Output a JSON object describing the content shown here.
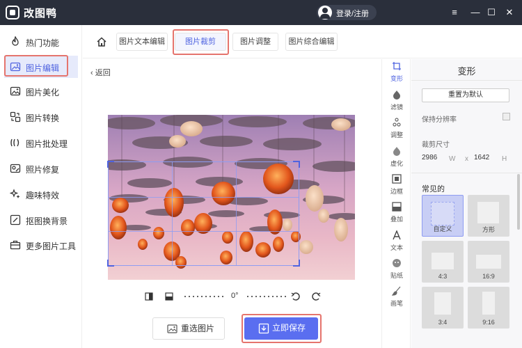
{
  "app": {
    "title": "改图鸭",
    "login": "登录/注册"
  },
  "window_controls": {
    "menu": "≡",
    "minimize": "—",
    "maximize": "☐",
    "close": "✕"
  },
  "sidebar": {
    "items": [
      {
        "label": "热门功能",
        "icon": "flame-icon"
      },
      {
        "label": "图片编辑",
        "icon": "image-edit-icon"
      },
      {
        "label": "图片美化",
        "icon": "image-beautify-icon"
      },
      {
        "label": "图片转换",
        "icon": "convert-icon"
      },
      {
        "label": "图片批处理",
        "icon": "batch-icon"
      },
      {
        "label": "照片修复",
        "icon": "repair-icon"
      },
      {
        "label": "趣味特效",
        "icon": "sparkle-icon"
      },
      {
        "label": "抠图换背景",
        "icon": "cutout-icon"
      },
      {
        "label": "更多图片工具",
        "icon": "toolbox-icon"
      }
    ],
    "active_index": 1
  },
  "tabs": [
    {
      "label": "图片文本编辑"
    },
    {
      "label": "图片裁剪"
    },
    {
      "label": "图片调整"
    },
    {
      "label": "图片综合编辑"
    }
  ],
  "active_tab": 1,
  "back_label": "返回",
  "rotation": {
    "degree": "0°"
  },
  "buttons": {
    "reselect": "重选图片",
    "save": "立即保存"
  },
  "tools": [
    {
      "label": "变形",
      "icon": "transform-icon"
    },
    {
      "label": "滤镜",
      "icon": "filter-icon"
    },
    {
      "label": "调整",
      "icon": "adjust-icon"
    },
    {
      "label": "虚化",
      "icon": "blur-icon"
    },
    {
      "label": "边框",
      "icon": "frame-icon"
    },
    {
      "label": "叠加",
      "icon": "overlay-icon"
    },
    {
      "label": "文本",
      "icon": "text-icon"
    },
    {
      "label": "贴纸",
      "icon": "sticker-icon"
    },
    {
      "label": "画笔",
      "icon": "brush-icon"
    }
  ],
  "panel": {
    "title": "变形",
    "reset": "重置为默认",
    "keep_resolution": "保持分辨率",
    "crop_size": "裁剪尺寸",
    "width": "2986",
    "w_unit": "W",
    "x": "x",
    "height": "1642",
    "h_unit": "H",
    "common": "常见的",
    "presets": [
      "自定义",
      "方形",
      "4:3",
      "16:9",
      "3:4",
      "9:16"
    ]
  },
  "colors": {
    "accent": "#5a6ef0",
    "highlight": "#e5746d",
    "titlebar": "#2a2f3b"
  }
}
